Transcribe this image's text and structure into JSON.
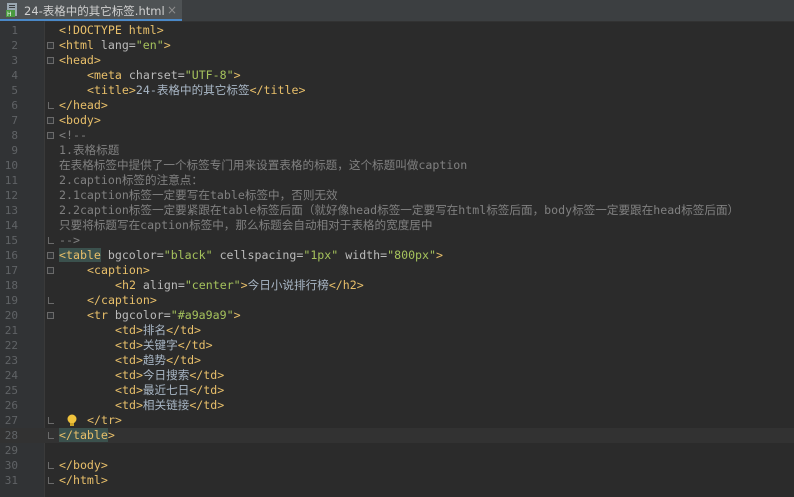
{
  "tab": {
    "title": "24-表格中的其它标签.html",
    "close_glyph": "×",
    "icon": "html-file-icon"
  },
  "editor": {
    "line_numbers": [
      "1",
      "2",
      "3",
      "4",
      "5",
      "6",
      "7",
      "8",
      "9",
      "10",
      "11",
      "12",
      "13",
      "14",
      "15",
      "16",
      "17",
      "18",
      "19",
      "20",
      "21",
      "22",
      "23",
      "24",
      "25",
      "26",
      "27",
      "28",
      "29",
      "30",
      "31"
    ],
    "code": {
      "l1": "<!DOCTYPE html>",
      "l2_open": "<html ",
      "l2_attr": "lang=",
      "l2_val": "\"en\"",
      "l2_close": ">",
      "l3": "<head>",
      "l4_open": "<meta ",
      "l4_attr": "charset=",
      "l4_val": "\"UTF-8\"",
      "l4_close": ">",
      "l5_open": "<title>",
      "l5_text": "24-表格中的其它标签",
      "l5_close": "</title>",
      "l6": "</head>",
      "l7": "<body>",
      "l8": "<!--",
      "l9": "1.表格标题",
      "l10": "在表格标签中提供了一个标签专门用来设置表格的标题，这个标题叫做caption",
      "l11": "2.caption标签的注意点：",
      "l12": "2.1caption标签一定要写在table标签中，否则无效",
      "l13": "2.2caption标签一定要紧跟在table标签后面（就好像head标签一定要写在html标签后面，body标签一定要跟在head标签后面）",
      "l14": "只要将标题写在caption标签中，那么标题会自动相对于表格的宽度居中",
      "l15": "-->",
      "l16_open": "<table",
      "l16_attr1": " bgcolor=",
      "l16_val1": "\"black\"",
      "l16_attr2": " cellspacing=",
      "l16_val2": "\"1px\"",
      "l16_attr3": " width=",
      "l16_val3": "\"800px\"",
      "l16_close": ">",
      "l17": "<caption>",
      "l18_open": "<h2 ",
      "l18_attr": "align=",
      "l18_val": "\"center\"",
      "l18_gt": ">",
      "l18_text": "今日小说排行榜",
      "l18_close": "</h2>",
      "l19": "</caption>",
      "l20_open": "<tr ",
      "l20_attr": "bgcolor=",
      "l20_val": "\"#a9a9a9\"",
      "l20_close": ">",
      "td_open": "<td>",
      "td_close": "</td>",
      "l21_text": "排名",
      "l22_text": "关键字",
      "l23_text": "趋势",
      "l24_text": "今日搜索",
      "l25_text": "最近七日",
      "l26_text": "相关链接",
      "l27": "</tr>",
      "l28_open": "</table",
      "l28_close": ">",
      "l30": "</body>",
      "l31": "</html>"
    },
    "current_line": "28",
    "colors": {
      "background": "#2b2b2b",
      "tag": "#e8bf6a",
      "attribute": "#bababa",
      "value": "#a5c25c",
      "comment": "#808080",
      "text": "#a9b7c6"
    }
  }
}
